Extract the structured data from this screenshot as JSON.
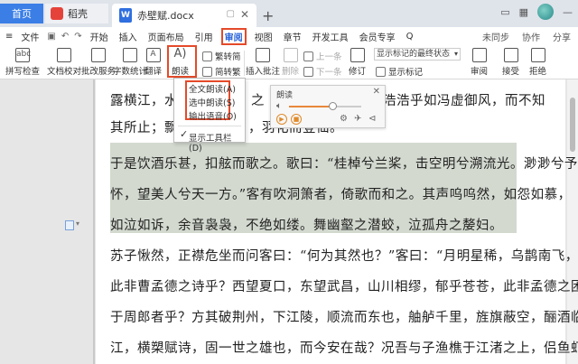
{
  "tabs": {
    "home": "首页",
    "daoke": "稻壳",
    "document": "赤壁赋.docx"
  },
  "menu": {
    "file": "文件",
    "items": [
      "开始",
      "插入",
      "页面布局",
      "引用",
      "审阅",
      "视图",
      "章节",
      "开发工具",
      "会员专享"
    ],
    "search": "Q",
    "right": [
      "未同步",
      "协作",
      "分享"
    ]
  },
  "ribbon": {
    "spellcheck": "拼写检查",
    "doc_proof": "文档校对",
    "annotate": "批改服务",
    "wordcount": "字数统计",
    "translate": "翻译",
    "read_aloud": "朗读",
    "trad_to_simp": "繁转简",
    "simp_to_trad": "简转繁",
    "insert_comment": "插入批注",
    "delete": "删除",
    "prev": "上一条",
    "next": "下一条",
    "revise": "修订",
    "track_status": "显示标记的最终状态",
    "show_marks": "显示标记",
    "review": "审阅",
    "accept": "接受",
    "reject": "拒绝"
  },
  "dropdown": {
    "full_read": "全文朗读(A)",
    "selected_read": "选中朗读(S)",
    "export_audio": "输出语音(O)",
    "show_toolbar": "显示工具栏(D)"
  },
  "reader": {
    "title": "朗读",
    "progress": 0.6
  },
  "document": {
    "lines": [
      "露横江，水光接天。纵一苇之所如，凌万顷之茫然。浩浩乎如冯虚御风，而不知",
      "其所止；飘飘乎如遗世独立，羽化而登仙。",
      "于是饮酒乐甚，扣舷而歌之。歌曰：“桂棹兮兰桨，击空明兮溯流光。渺渺兮予",
      "怀，望美人兮天一方。”客有吹洞箫者，倚歌而和之。其声呜呜然，如怨如慕，",
      "如泣如诉，余音袅袅，不绝如缕。舞幽壑之潜蛟，泣孤舟之嫠妇。",
      "苏子愀然，正襟危坐而问客曰：“何为其然也？”客曰：“月明星稀，乌鹊南飞，",
      "此非曹孟德之诗乎？西望夏口，东望武昌，山川相缪，郁乎苍苍，此非孟德之困",
      "于周郎者乎？方其破荆州，下江陵，顺流而东也，舳舻千里，旌旗蔽空，酾酒临",
      "江，横槊赋诗，固一世之雄也，而今安在哉？况吾与子渔樵于江渚之上，侣鱼虾"
    ],
    "visible_lines": [
      "露横江，水",
      "其所止；飘",
      "于是饮酒乐甚，扣舷而歌之。歌曰：“桂棹兮兰桨，击空明兮溯流光。渺渺兮予",
      "怀，望美人兮天一方。”客有吹洞箫者，倚歌而和之。其声呜呜然，如怨如慕，",
      "如泣如诉，余音袅袅，不绝如缕。舞幽壑之潜蛟，泣孤舟之嫠妇。",
      "苏子愀然，正襟危坐而问客曰：“何为其然也？”客曰：“月明星稀，乌鹊南飞，",
      "此非曹孟德之诗乎？西望夏口，东望武昌，山川相缪，郁乎苍苍，此非孟德之困",
      "于周郎者乎？方其破荆州，下江陵，顺流而东也，舳舻千里，旌旗蔽空，酾酒临",
      "江，横槊赋诗，固一世之雄也，而今安在哉？况吾与子渔樵于江渚之上，侣鱼虾"
    ],
    "line1_right": "浩浩乎如冯虚御风，而不知",
    "line2_right": "，羽化而登仙。",
    "line1_mid": "之"
  },
  "colors": {
    "accent": "#3a7ee6",
    "highlight": "#d3d9cf",
    "annotation": "#e44a2a"
  }
}
